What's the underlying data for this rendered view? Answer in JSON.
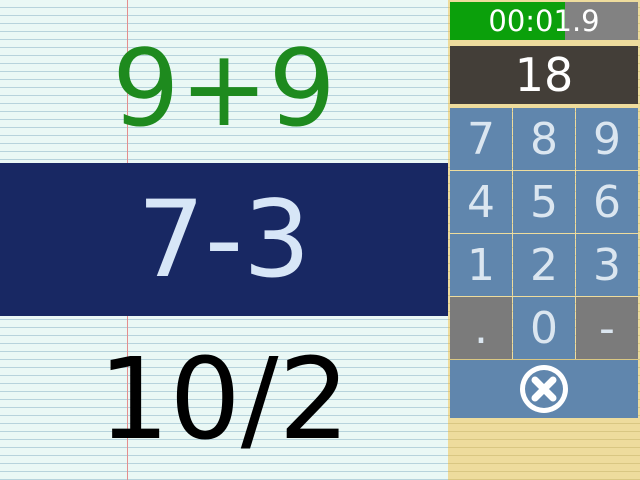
{
  "problems": {
    "previous": "9+9",
    "current": "7-3",
    "next": "10/2"
  },
  "timer": {
    "text": "00:01.9",
    "progress_percent": 61
  },
  "answer": "18",
  "keypad": {
    "rows": [
      [
        "7",
        "8",
        "9"
      ],
      [
        "4",
        "5",
        "6"
      ],
      [
        "1",
        "2",
        "3"
      ],
      [
        ".",
        "0",
        "-"
      ]
    ],
    "clear_icon": "clear-circle-x-icon"
  },
  "colors": {
    "previous_problem": "#1e8a1e",
    "current_highlight": "#182863",
    "next_problem": "#000000",
    "keypad_blue": "#6086ad",
    "timer_green": "#0ba00b"
  }
}
